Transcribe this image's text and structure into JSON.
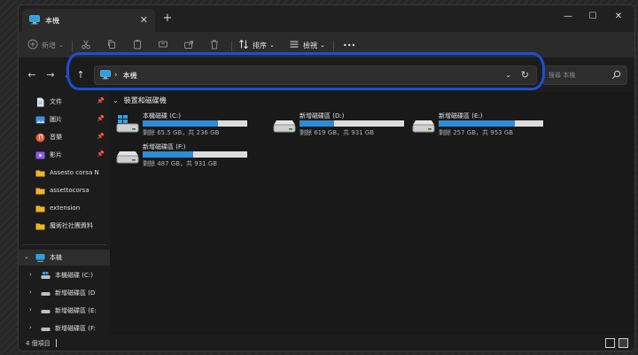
{
  "window": {
    "tab_title": "本機",
    "close_tab": "✕",
    "add_tab": "+",
    "minimize": "—",
    "maximize": "☐",
    "close": "✕"
  },
  "toolbar": {
    "new_label": "新增",
    "sort_label": "排序",
    "view_label": "檢視",
    "more": "•••"
  },
  "nav": {
    "back": "←",
    "forward": "→",
    "up": "↑",
    "address_text": "本機",
    "breadcrumb_sep": "›",
    "search_placeholder": "搜尋 本機"
  },
  "sidebar": {
    "quick_access": [
      {
        "label": "文件",
        "icon": "documents-icon",
        "pinned": true
      },
      {
        "label": "圖片",
        "icon": "pictures-icon",
        "pinned": true
      },
      {
        "label": "音樂",
        "icon": "music-icon",
        "pinned": true
      },
      {
        "label": "影片",
        "icon": "videos-icon",
        "pinned": true
      },
      {
        "label": "Assesto corsa N",
        "icon": "folder-icon",
        "pinned": false
      },
      {
        "label": "assettocorsa",
        "icon": "folder-icon",
        "pinned": false
      },
      {
        "label": "extension",
        "icon": "folder-icon",
        "pinned": false
      },
      {
        "label": "魔術社社團資料",
        "icon": "folder-icon",
        "pinned": false
      }
    ],
    "this_pc": "本機",
    "drives": [
      {
        "label": "本機磁碟 (C:)"
      },
      {
        "label": "新增磁碟區 (D"
      },
      {
        "label": "新增磁碟區 (E:"
      },
      {
        "label": "新增磁碟區 (F:"
      }
    ]
  },
  "main": {
    "group_title": "裝置和磁碟機",
    "drives": [
      {
        "name": "本機磁碟 (C:)",
        "free_text": "剩餘 65.5 GB，共 236 GB",
        "used_fraction": 0.72,
        "system": true
      },
      {
        "name": "新增磁碟區 (D:)",
        "free_text": "剩餘 619 GB，共 931 GB",
        "used_fraction": 0.33,
        "system": false
      },
      {
        "name": "新增磁碟區 (E:)",
        "free_text": "剩餘 257 GB，共 953 GB",
        "used_fraction": 0.73,
        "system": false
      },
      {
        "name": "新增磁碟區 (F:)",
        "free_text": "剩餘 487 GB，共 931 GB",
        "used_fraction": 0.48,
        "system": false
      }
    ]
  },
  "status": {
    "item_count": "4 個項目"
  },
  "colors": {
    "accent": "#2c8bd6",
    "annotation": "#1d4ed8"
  }
}
